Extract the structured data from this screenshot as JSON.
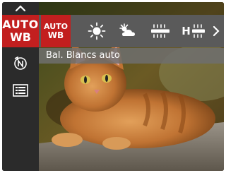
{
  "rail": {
    "items": [
      {
        "name": "up-arrow",
        "icon": "chevron-up-icon"
      },
      {
        "name": "white-balance",
        "label_line1": "AUTO",
        "label_line2": "WB",
        "selected": true
      },
      {
        "name": "scene-mode",
        "icon": "scene-n-icon"
      },
      {
        "name": "menu",
        "icon": "menu-list-icon"
      }
    ]
  },
  "options": {
    "selected": {
      "line1": "AUTO",
      "line2": "WB"
    },
    "items": [
      {
        "name": "auto-wb",
        "icon": "auto-wb-icon"
      },
      {
        "name": "daylight",
        "icon": "sun-icon"
      },
      {
        "name": "cloudy",
        "icon": "cloud-icon"
      },
      {
        "name": "fluorescent",
        "icon": "fluorescent-icon"
      },
      {
        "name": "fluorescent-h",
        "icon": "fluorescent-h-icon"
      },
      {
        "name": "next",
        "icon": "chevron-right-icon"
      }
    ],
    "fluorescent_h_letter": "H"
  },
  "label": {
    "text": "Bal. Blancs auto"
  },
  "colors": {
    "accent": "#c21f1f",
    "rail": "#2b2b2b",
    "bar": "#5a5a5a"
  }
}
